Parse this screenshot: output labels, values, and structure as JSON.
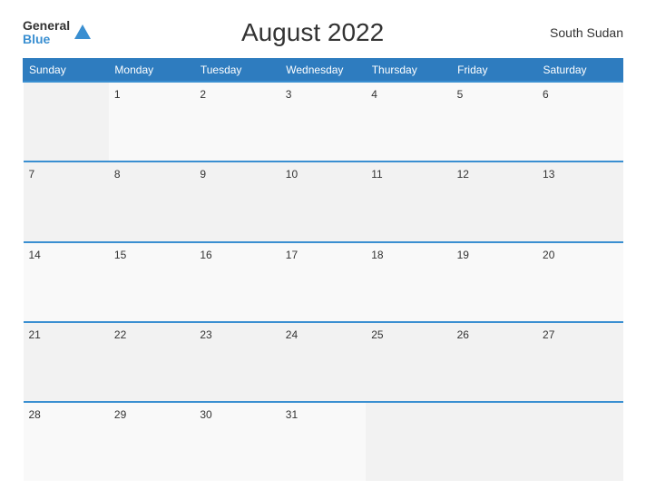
{
  "header": {
    "logo_general": "General",
    "logo_blue": "Blue",
    "title": "August 2022",
    "country": "South Sudan"
  },
  "days_of_week": [
    "Sunday",
    "Monday",
    "Tuesday",
    "Wednesday",
    "Thursday",
    "Friday",
    "Saturday"
  ],
  "weeks": [
    [
      "",
      "1",
      "2",
      "3",
      "4",
      "5",
      "6"
    ],
    [
      "7",
      "8",
      "9",
      "10",
      "11",
      "12",
      "13"
    ],
    [
      "14",
      "15",
      "16",
      "17",
      "18",
      "19",
      "20"
    ],
    [
      "21",
      "22",
      "23",
      "24",
      "25",
      "26",
      "27"
    ],
    [
      "28",
      "29",
      "30",
      "31",
      "",
      "",
      ""
    ]
  ]
}
